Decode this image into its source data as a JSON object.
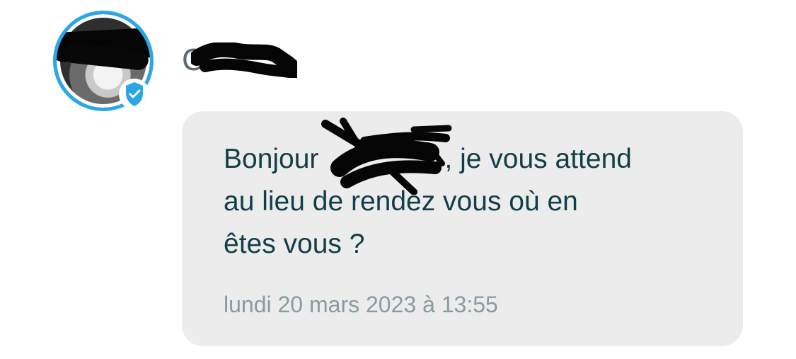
{
  "sender": {
    "name_visible": "C",
    "verified": true,
    "badge_color": "#2aa7e8",
    "icons": {
      "avatar": "avatar-photo",
      "badge": "verified-shield-icon"
    }
  },
  "message": {
    "line1_prefix": "Bonjour",
    "line1_suffix": ", je vous attend",
    "line2": "au lieu de rendez vous où en",
    "line3": "êtes vous ?",
    "timestamp": "lundi 20 mars 2023 à 13:55"
  },
  "colors": {
    "message_text": "#123e47",
    "bubble_bg": "#ececec",
    "timestamp_text": "#8a9aa1"
  }
}
